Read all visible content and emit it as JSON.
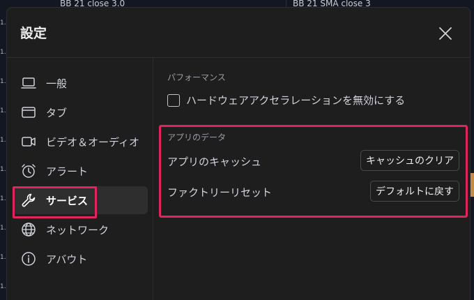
{
  "background": {
    "pane_labels": [
      "BB 21 close 3.0",
      "BB 21 SMA close 3"
    ],
    "axis_ticks": [
      "1.",
      "1.",
      "1.",
      "1.",
      "1.",
      "1.",
      "1.",
      "1.",
      "1.",
      "1."
    ]
  },
  "dialog": {
    "title": "設定"
  },
  "sidebar": {
    "items": [
      {
        "label": "一般",
        "icon": "laptop-icon"
      },
      {
        "label": "タブ",
        "icon": "window-icon"
      },
      {
        "label": "ビデオ＆オーディオ",
        "icon": "video-camera-icon"
      },
      {
        "label": "アラート",
        "icon": "alarm-clock-icon"
      },
      {
        "label": "サービス",
        "icon": "wrench-icon"
      },
      {
        "label": "ネットワーク",
        "icon": "globe-icon"
      },
      {
        "label": "アバウト",
        "icon": "info-icon"
      }
    ],
    "active_index": 4
  },
  "performance": {
    "section_title": "パフォーマンス",
    "hw_accel_label": "ハードウェアアクセラレーションを無効にする",
    "hw_accel_checked": false
  },
  "app_data": {
    "section_title": "アプリのデータ",
    "cache_label": "アプリのキャッシュ",
    "cache_button": "キャッシュのクリア",
    "reset_label": "ファクトリーリセット",
    "reset_button": "デフォルトに戻す"
  },
  "colors": {
    "highlight": "#e0245e",
    "dialog_bg": "#1e1e1e",
    "active_item_bg": "#2e2e2e"
  }
}
